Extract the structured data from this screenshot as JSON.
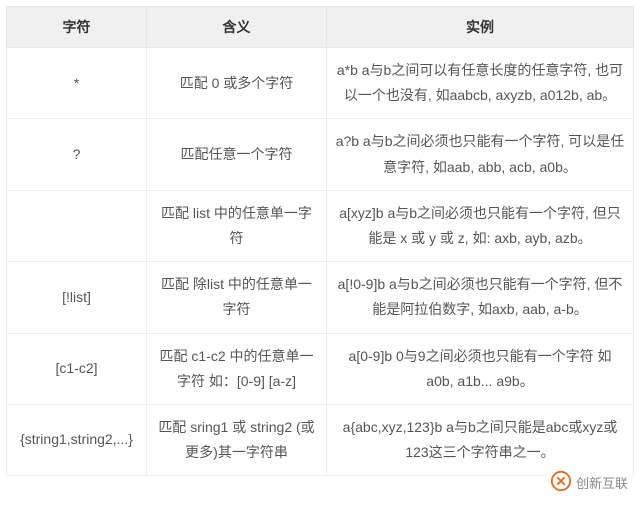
{
  "headers": {
    "col1": "字符",
    "col2": "含义",
    "col3": "实例"
  },
  "rows": [
    {
      "char": "*",
      "meaning": "匹配 0 或多个字符",
      "example": "a*b  a与b之间可以有任意长度的任意字符, 也可以一个也没有, 如aabcb, axyzb, a012b, ab。"
    },
    {
      "char": "?",
      "meaning": "匹配任意一个字符",
      "example": "a?b  a与b之间必须也只能有一个字符, 可以是任意字符, 如aab, abb, acb, a0b。"
    },
    {
      "char": "",
      "meaning": "匹配 list 中的任意单一字符",
      "example": "a[xyz]b   a与b之间必须也只能有一个字符, 但只能是 x 或 y 或 z, 如: axb, ayb, azb。"
    },
    {
      "char": "[!list]",
      "meaning": "匹配 除list 中的任意单一字符",
      "example": "a[!0-9]b  a与b之间必须也只能有一个字符, 但不能是阿拉伯数字, 如axb, aab, a-b。"
    },
    {
      "char": "[c1-c2]",
      "meaning": "匹配 c1-c2 中的任意单一字符 如：[0-9] [a-z]",
      "example": "a[0-9]b  0与9之间必须也只能有一个字符 如a0b, a1b... a9b。"
    },
    {
      "char": "{string1,string2,...}",
      "meaning": "匹配 sring1 或 string2 (或更多)其一字符串",
      "example": "a{abc,xyz,123}b    a与b之间只能是abc或xyz或123这三个字符串之一。"
    }
  ],
  "watermark": "创新互联"
}
